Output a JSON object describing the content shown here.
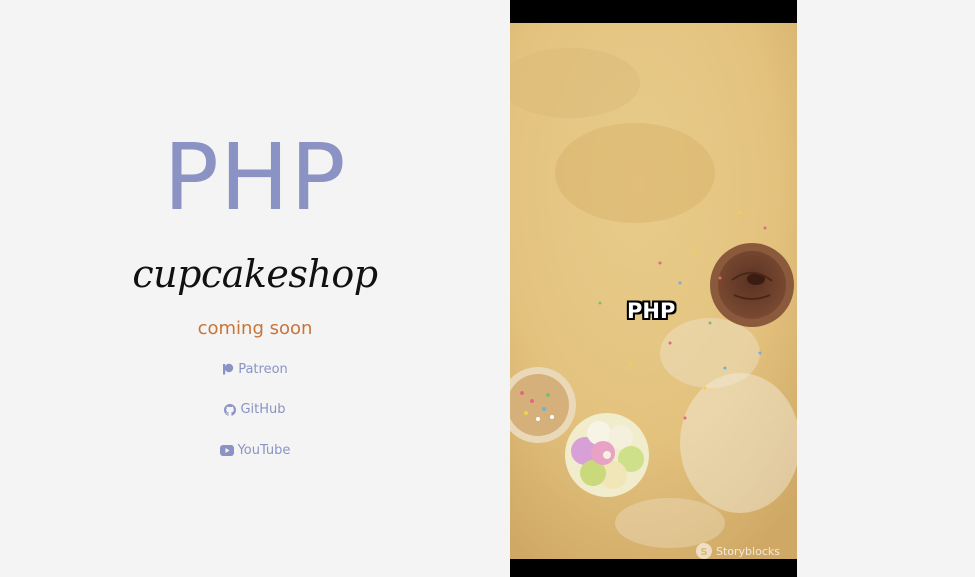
{
  "hero": {
    "logo_text": "PHP",
    "brand_name": "cupcakeshop",
    "tagline": "coming soon"
  },
  "links": [
    {
      "label": "Patreon",
      "icon": "patreon-icon"
    },
    {
      "label": "GitHub",
      "icon": "github-icon"
    },
    {
      "label": "YouTube",
      "icon": "youtube-icon"
    }
  ],
  "video": {
    "caption": "PHP",
    "watermark": "Storyblocks"
  },
  "colors": {
    "logo": "#8a93c3",
    "tagline": "#c8743a",
    "links": "#8a93c3",
    "background": "#f4f4f4"
  }
}
